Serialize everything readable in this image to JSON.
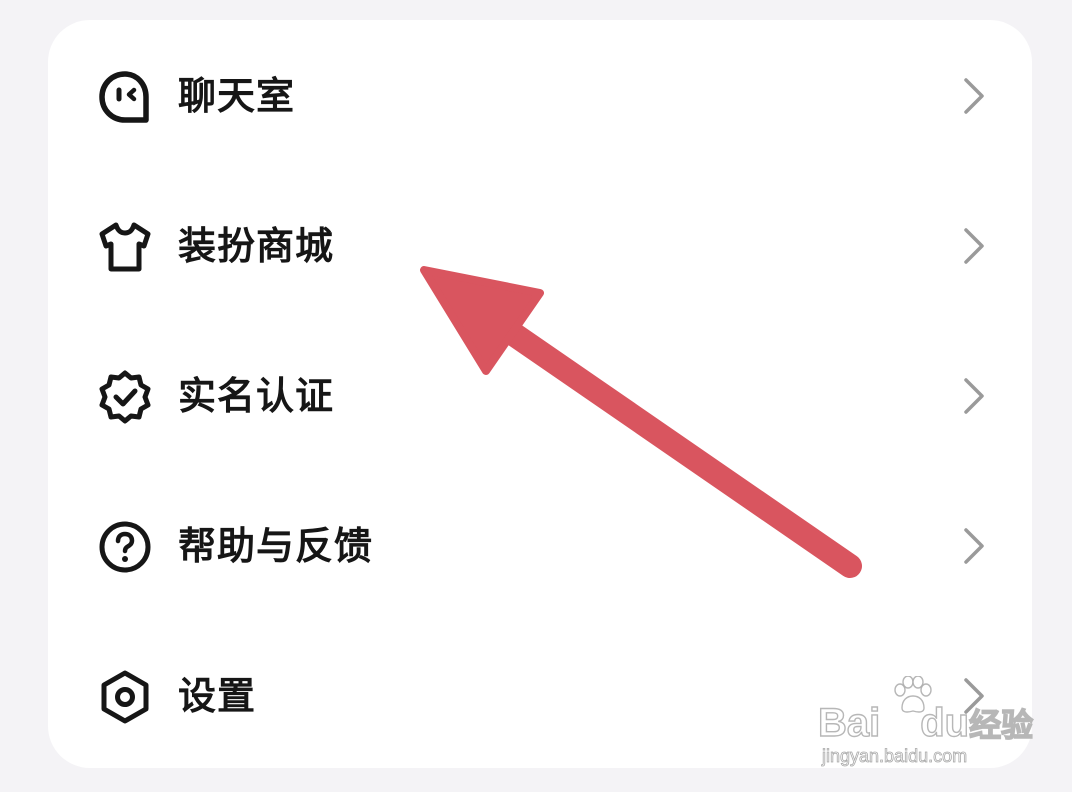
{
  "menu": {
    "items": [
      {
        "label": "聊天室",
        "icon": "chat-bubble-face-icon"
      },
      {
        "label": "装扮商城",
        "icon": "tshirt-icon"
      },
      {
        "label": "实名认证",
        "icon": "verified-badge-icon"
      },
      {
        "label": "帮助与反馈",
        "icon": "question-circle-icon"
      },
      {
        "label": "设置",
        "icon": "settings-hexagon-icon"
      }
    ],
    "chevron_icon": "chevron-right-icon"
  },
  "annotation": {
    "color": "#d9555f",
    "points_to": "装扮商城"
  },
  "watermark": {
    "brand": "Bai",
    "brand_icon": "paw-icon",
    "brand_suffix": "du",
    "brand_cn": "经验",
    "url": "jingyan.baidu.com"
  }
}
